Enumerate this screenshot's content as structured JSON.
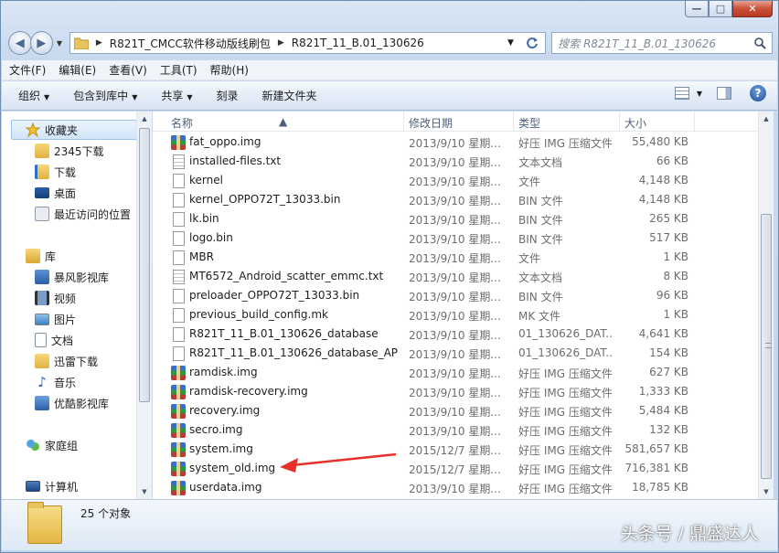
{
  "window": {
    "caption_buttons": {
      "minimize": "—",
      "maximize": "□",
      "close": "✕"
    }
  },
  "address_bar": {
    "breadcrumbs": [
      "R821T_CMCC软件移动版线刷包",
      "R821T_11_B.01_130626"
    ],
    "search_placeholder": "搜索 R821T_11_B.01_130626"
  },
  "menu": [
    "文件(F)",
    "编辑(E)",
    "查看(V)",
    "工具(T)",
    "帮助(H)"
  ],
  "toolbar": {
    "organize": "组织",
    "include_in_library": "包含到库中",
    "share": "共享",
    "burn": "刻录",
    "new_folder": "新建文件夹",
    "help": "?"
  },
  "nav": {
    "favorites": "收藏夹",
    "favorites_items": [
      "2345下载",
      "下载",
      "桌面",
      "最近访问的位置"
    ],
    "libraries": "库",
    "library_items": [
      "暴风影视库",
      "视频",
      "图片",
      "文档",
      "迅雷下载",
      "音乐",
      "优酷影视库"
    ],
    "homegroup": "家庭组",
    "computer": "计算机"
  },
  "columns": {
    "name": "名称",
    "date": "修改日期",
    "type": "类型",
    "size": "大小"
  },
  "files": [
    {
      "name": "fat_oppo.img",
      "date": "2013/9/10 星期...",
      "type": "好压 IMG 压缩文件",
      "size": "55,480 KB",
      "icon": "archive-icon"
    },
    {
      "name": "installed-files.txt",
      "date": "2013/9/10 星期...",
      "type": "文本文档",
      "size": "66 KB",
      "icon": "text-file-icon"
    },
    {
      "name": "kernel",
      "date": "2013/9/10 星期...",
      "type": "文件",
      "size": "4,148 KB",
      "icon": "file-icon"
    },
    {
      "name": "kernel_OPPO72T_13033.bin",
      "date": "2013/9/10 星期...",
      "type": "BIN 文件",
      "size": "4,148 KB",
      "icon": "file-icon"
    },
    {
      "name": "lk.bin",
      "date": "2013/9/10 星期...",
      "type": "BIN 文件",
      "size": "265 KB",
      "icon": "file-icon"
    },
    {
      "name": "logo.bin",
      "date": "2013/9/10 星期...",
      "type": "BIN 文件",
      "size": "517 KB",
      "icon": "file-icon"
    },
    {
      "name": "MBR",
      "date": "2013/9/10 星期...",
      "type": "文件",
      "size": "1 KB",
      "icon": "file-icon"
    },
    {
      "name": "MT6572_Android_scatter_emmc.txt",
      "date": "2013/9/10 星期...",
      "type": "文本文档",
      "size": "8 KB",
      "icon": "text-file-icon"
    },
    {
      "name": "preloader_OPPO72T_13033.bin",
      "date": "2013/9/10 星期...",
      "type": "BIN 文件",
      "size": "96 KB",
      "icon": "file-icon"
    },
    {
      "name": "previous_build_config.mk",
      "date": "2013/9/10 星期...",
      "type": "MK 文件",
      "size": "1 KB",
      "icon": "file-icon"
    },
    {
      "name": "R821T_11_B.01_130626_database",
      "date": "2013/9/10 星期...",
      "type": "01_130626_DAT...",
      "size": "4,641 KB",
      "icon": "file-icon"
    },
    {
      "name": "R821T_11_B.01_130626_database_AP",
      "date": "2013/9/10 星期...",
      "type": "01_130626_DAT...",
      "size": "154 KB",
      "icon": "file-icon"
    },
    {
      "name": "ramdisk.img",
      "date": "2013/9/10 星期...",
      "type": "好压 IMG 压缩文件",
      "size": "627 KB",
      "icon": "archive-icon"
    },
    {
      "name": "ramdisk-recovery.img",
      "date": "2013/9/10 星期...",
      "type": "好压 IMG 压缩文件",
      "size": "1,333 KB",
      "icon": "archive-icon"
    },
    {
      "name": "recovery.img",
      "date": "2013/9/10 星期...",
      "type": "好压 IMG 压缩文件",
      "size": "5,484 KB",
      "icon": "archive-icon"
    },
    {
      "name": "secro.img",
      "date": "2013/9/10 星期...",
      "type": "好压 IMG 压缩文件",
      "size": "132 KB",
      "icon": "archive-icon"
    },
    {
      "name": "system.img",
      "date": "2015/12/7 星期...",
      "type": "好压 IMG 压缩文件",
      "size": "581,657 KB",
      "icon": "archive-icon"
    },
    {
      "name": "system_old.img",
      "date": "2015/12/7 星期...",
      "type": "好压 IMG 压缩文件",
      "size": "716,381 KB",
      "icon": "archive-icon"
    },
    {
      "name": "userdata.img",
      "date": "2013/9/10 星期...",
      "type": "好压 IMG 压缩文件",
      "size": "18,785 KB",
      "icon": "archive-icon"
    }
  ],
  "status": {
    "count": "25 个对象"
  },
  "watermark": "头条号 / 鼎盛达人",
  "colors": {
    "annotation_arrow": "#e8302a",
    "selection": "#d2e5f9"
  }
}
